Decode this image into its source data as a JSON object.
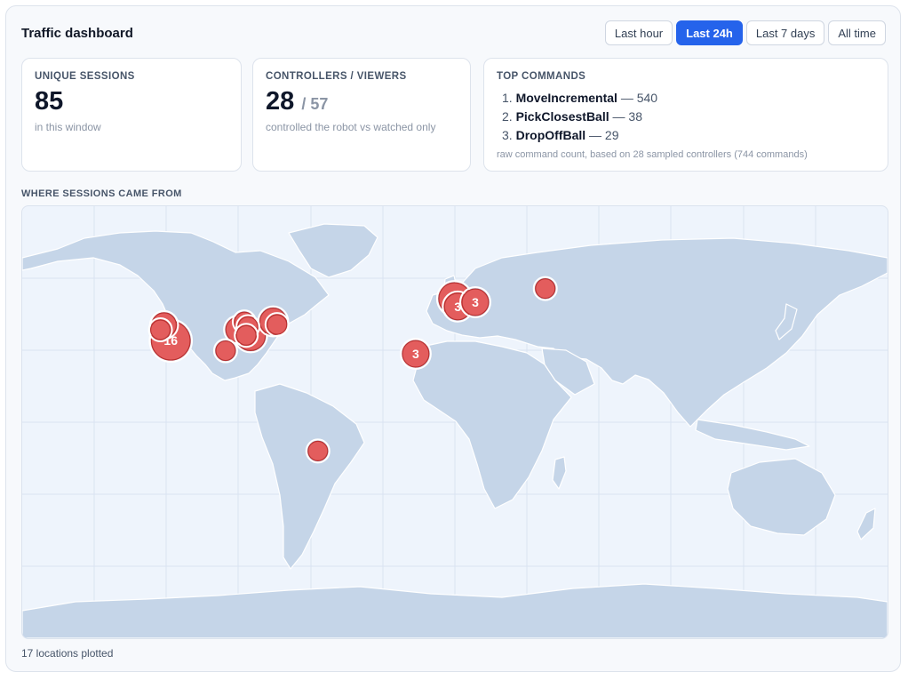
{
  "header": {
    "title": "Traffic dashboard"
  },
  "range_buttons": [
    {
      "label": "Last hour",
      "active": false
    },
    {
      "label": "Last 24h",
      "active": true
    },
    {
      "label": "Last 7 days",
      "active": false
    },
    {
      "label": "All time",
      "active": false
    }
  ],
  "sessions_card": {
    "label": "UNIQUE SESSIONS",
    "value": "85",
    "caption": "in this window"
  },
  "controllers_card": {
    "label": "CONTROLLERS / VIEWERS",
    "value": "28",
    "secondary": "/ 57",
    "caption": "controlled the robot vs watched only"
  },
  "commands_card": {
    "label": "TOP COMMANDS",
    "items": [
      {
        "rank": "1.",
        "name": "MoveIncremental",
        "count": "— 540"
      },
      {
        "rank": "2.",
        "name": "PickClosestBall",
        "count": "— 38"
      },
      {
        "rank": "3.",
        "name": "DropOffBall",
        "count": "— 29"
      }
    ],
    "note": "raw command count, based on 28 sampled controllers (744 commands)"
  },
  "map": {
    "label": "WHERE SESSIONS CAME FROM",
    "colors": {
      "ocean": "#eef4fc",
      "land": "#c5d5e8",
      "marker": "#e35d5d",
      "marker_stroke": "#b83232"
    },
    "markers": [
      {
        "lat": 38.5,
        "lon": -122.5,
        "count": ""
      },
      {
        "lat": 40.5,
        "lon": -121.0,
        "count": "2"
      },
      {
        "lat": 34.0,
        "lon": -118.2,
        "count": "16"
      },
      {
        "lat": 41.8,
        "lon": -87.6,
        "count": ""
      },
      {
        "lat": 39.8,
        "lon": -86.1,
        "count": ""
      },
      {
        "lat": 36.2,
        "lon": -86.8,
        "count": ""
      },
      {
        "lat": 29.8,
        "lon": -95.4,
        "count": ""
      },
      {
        "lat": 38.6,
        "lon": -90.2,
        "count": "2"
      },
      {
        "lat": 36.0,
        "lon": -85.0,
        "count": "5"
      },
      {
        "lat": 40.7,
        "lon": -74.0,
        "count": ""
      },
      {
        "lat": 42.0,
        "lon": -75.6,
        "count": "3"
      },
      {
        "lat": -12.0,
        "lon": -57.0,
        "count": ""
      },
      {
        "lat": 28.5,
        "lon": -16.3,
        "count": "3"
      },
      {
        "lat": 51.5,
        "lon": -0.1,
        "count": "7"
      },
      {
        "lat": 48.2,
        "lon": 1.2,
        "count": "3"
      },
      {
        "lat": 50.0,
        "lon": 8.5,
        "count": "3"
      },
      {
        "lat": 55.7,
        "lon": 37.6,
        "count": ""
      }
    ]
  },
  "footer": {
    "text": "17 locations plotted"
  }
}
